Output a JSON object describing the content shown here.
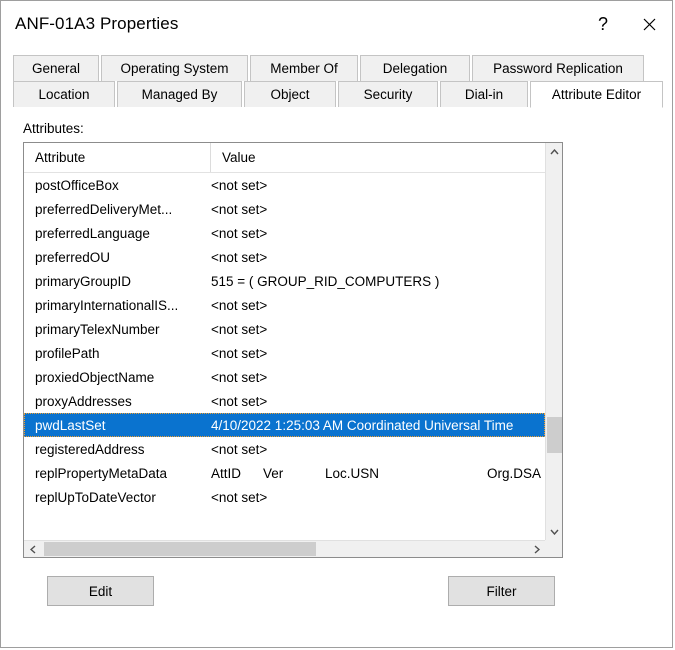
{
  "window": {
    "title": "ANF-01A3 Properties",
    "help_label": "?",
    "close_label": "✕"
  },
  "tabs": {
    "row1": [
      {
        "label": "General",
        "selected": false
      },
      {
        "label": "Operating System",
        "selected": false
      },
      {
        "label": "Member Of",
        "selected": false
      },
      {
        "label": "Delegation",
        "selected": false
      },
      {
        "label": "Password Replication",
        "selected": false
      }
    ],
    "row2": [
      {
        "label": "Location",
        "selected": false
      },
      {
        "label": "Managed By",
        "selected": false
      },
      {
        "label": "Object",
        "selected": false
      },
      {
        "label": "Security",
        "selected": false
      },
      {
        "label": "Dial-in",
        "selected": false
      },
      {
        "label": "Attribute Editor",
        "selected": true
      }
    ]
  },
  "panel": {
    "attributes_label": "Attributes:",
    "columns": {
      "attribute": "Attribute",
      "value": "Value"
    },
    "rows": [
      {
        "attribute": "postOfficeBox",
        "value": "<not set>",
        "selected": false
      },
      {
        "attribute": "preferredDeliveryMet...",
        "value": "<not set>",
        "selected": false
      },
      {
        "attribute": "preferredLanguage",
        "value": "<not set>",
        "selected": false
      },
      {
        "attribute": "preferredOU",
        "value": "<not set>",
        "selected": false
      },
      {
        "attribute": "primaryGroupID",
        "value": "515 = ( GROUP_RID_COMPUTERS )",
        "selected": false
      },
      {
        "attribute": "primaryInternationalIS...",
        "value": "<not set>",
        "selected": false
      },
      {
        "attribute": "primaryTelexNumber",
        "value": "<not set>",
        "selected": false
      },
      {
        "attribute": "profilePath",
        "value": "<not set>",
        "selected": false
      },
      {
        "attribute": "proxiedObjectName",
        "value": "<not set>",
        "selected": false
      },
      {
        "attribute": "proxyAddresses",
        "value": "<not set>",
        "selected": false
      },
      {
        "attribute": "pwdLastSet",
        "value": "4/10/2022 1:25:03 AM Coordinated Universal Time",
        "selected": true
      },
      {
        "attribute": "registeredAddress",
        "value": "<not set>",
        "selected": false
      },
      {
        "attribute": "replPropertyMetaData",
        "value": "AttID  Ver  Loc.USN  Org.DSA",
        "selected": false,
        "meta": {
          "attid": "AttID",
          "ver": "Ver",
          "locusn": "Loc.USN",
          "orgdsa": "Org.DSA"
        }
      },
      {
        "attribute": "replUpToDateVector",
        "value": "<not set>",
        "selected": false
      }
    ]
  },
  "scrollbars": {
    "vertical": {
      "up_icon": "chevron-up",
      "down_icon": "chevron-down"
    },
    "horizontal": {
      "left_icon": "chevron-left",
      "right_icon": "chevron-right"
    }
  },
  "buttons": {
    "edit": "Edit",
    "filter": "Filter"
  },
  "colors": {
    "selection": "#0a73cf",
    "focus_outline": "#f0a030",
    "dialog_border": "#9e9e9e",
    "tab_face": "#f0f0f0",
    "button_face": "#e1e1e1",
    "scroll_thumb": "#cdcdcd"
  }
}
